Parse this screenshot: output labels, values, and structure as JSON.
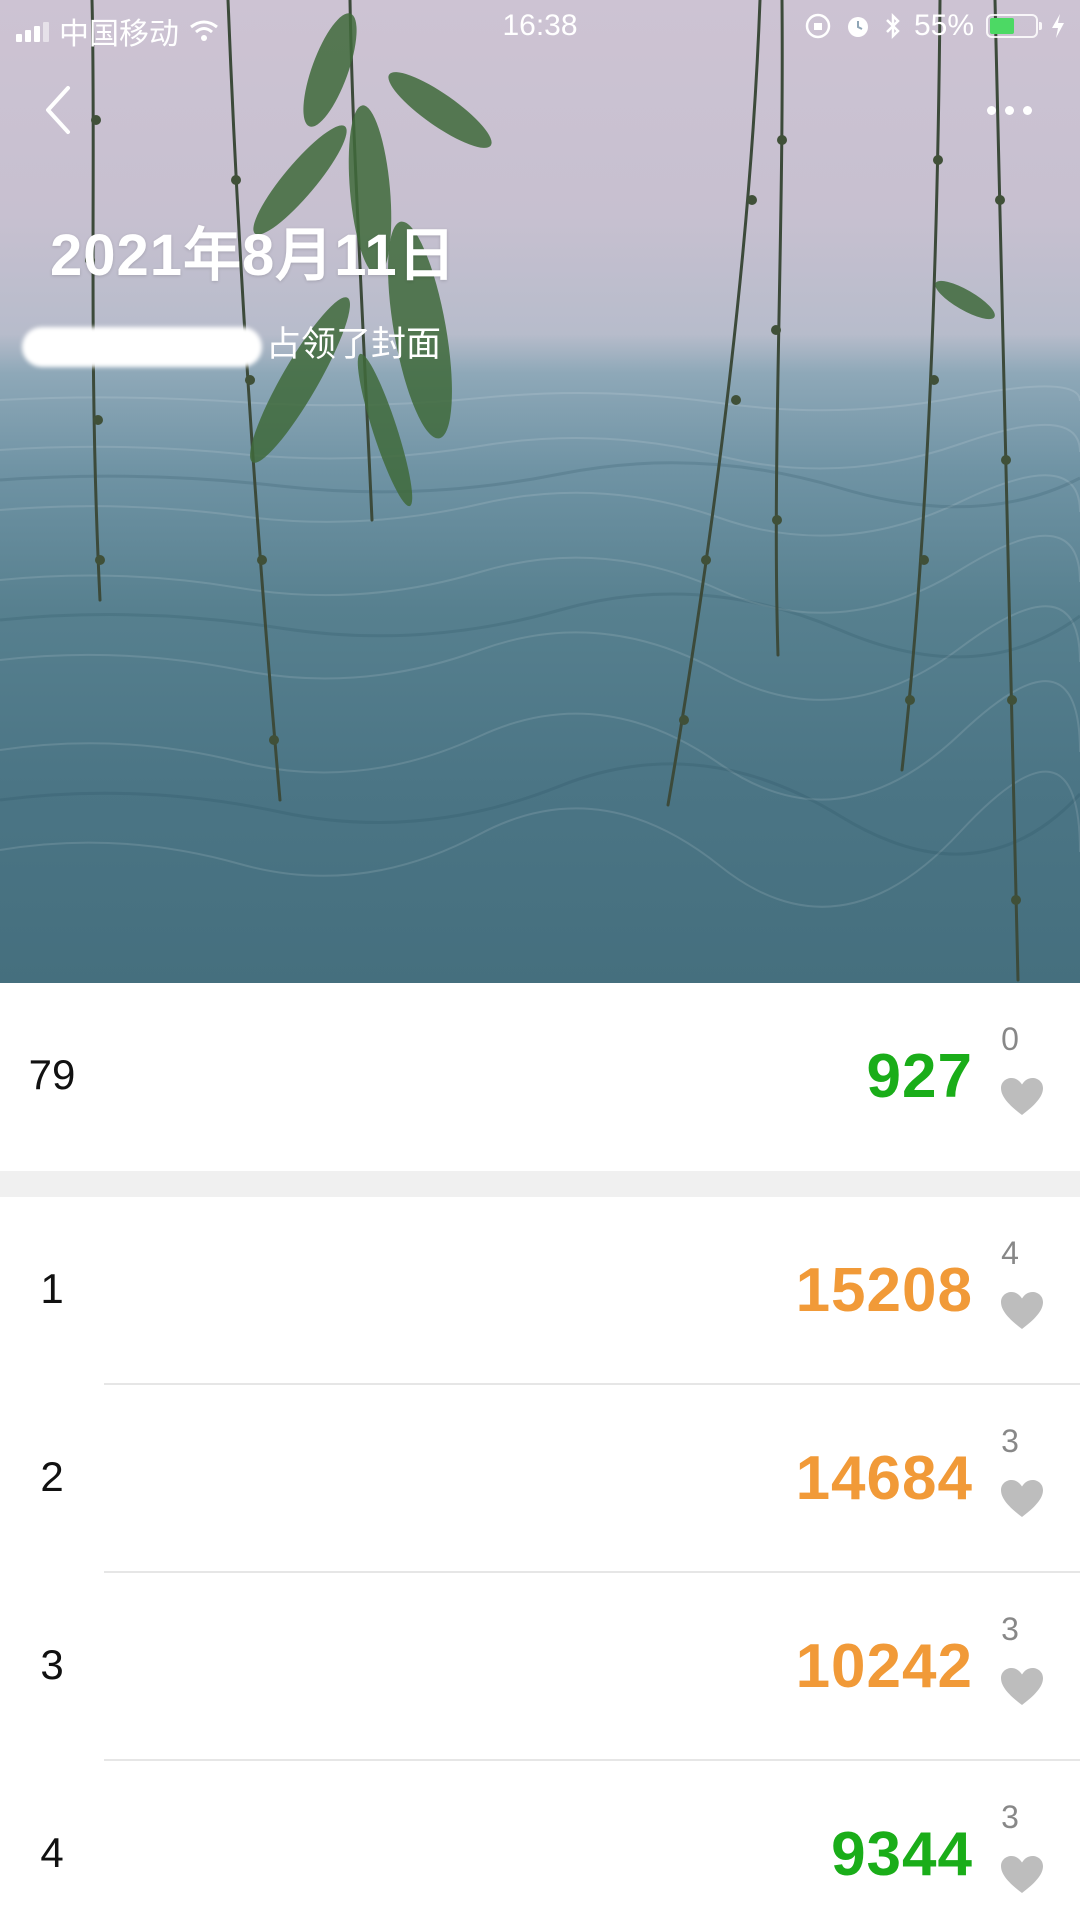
{
  "status_bar": {
    "carrier": "中国移动",
    "time": "16:38",
    "battery_percent": "55%",
    "battery_level": 0.55,
    "battery_color": "#4cd964"
  },
  "header": {
    "back_icon": "chevron-left-icon",
    "more_icon": "more-dots-icon"
  },
  "cover": {
    "date": "2021年8月11日",
    "owner_text": "占领了封面"
  },
  "my_rank": {
    "rank": "79",
    "steps": "927",
    "likes": "0",
    "steps_color": "#1aad19"
  },
  "ranking": [
    {
      "rank": "1",
      "steps": "15208",
      "likes": "4",
      "tone": "orange"
    },
    {
      "rank": "2",
      "steps": "14684",
      "likes": "3",
      "tone": "orange"
    },
    {
      "rank": "3",
      "steps": "10242",
      "likes": "3",
      "tone": "orange"
    },
    {
      "rank": "4",
      "steps": "9344",
      "likes": "3",
      "tone": "green"
    }
  ],
  "colors": {
    "green_steps": "#1aad19",
    "orange_steps": "#f19a38",
    "heart": "#bdbdbd"
  }
}
